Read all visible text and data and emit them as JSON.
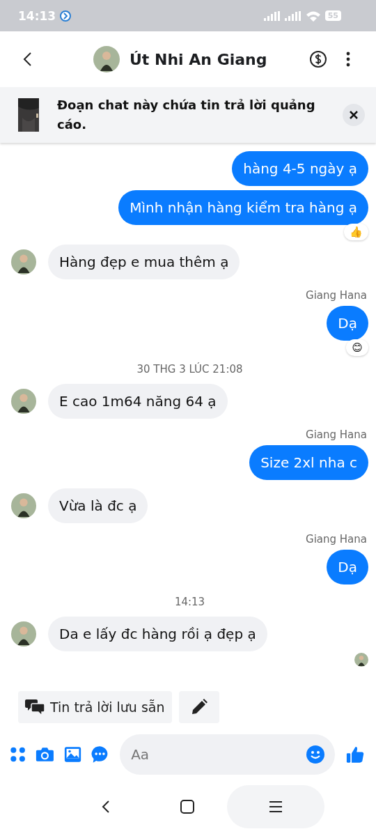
{
  "status_bar": {
    "time": "14:13",
    "battery": "55"
  },
  "header": {
    "title": "Út Nhi An Giang"
  },
  "banner": {
    "text": "Đoạn chat này chứa tin trả lời quảng cáo.",
    "kind": "picture"
  },
  "messages": [
    {
      "kind": "outgoing",
      "text": "hàng 4-5 ngày ạ"
    },
    {
      "kind": "outgoing",
      "text": "Mình nhận hàng kiểm tra hàng ạ",
      "reaction": "👍"
    },
    {
      "kind": "incoming",
      "text": "Hàng đẹp e mua thêm ạ"
    },
    {
      "kind": "sender",
      "text": "Giang Hana"
    },
    {
      "kind": "outgoing",
      "text": "Dạ",
      "reaction": "😊"
    },
    {
      "kind": "timestamp",
      "text": "30 THG 3 LÚC 21:08"
    },
    {
      "kind": "incoming",
      "text": "E cao 1m64 năng 64 ạ"
    },
    {
      "kind": "sender",
      "text": "Giang Hana"
    },
    {
      "kind": "outgoing",
      "text": "Size 2xl nha c"
    },
    {
      "kind": "incoming",
      "text": "Vừa là đc ạ"
    },
    {
      "kind": "sender",
      "text": "Giang Hana"
    },
    {
      "kind": "outgoing",
      "text": "Dạ"
    },
    {
      "kind": "timestamp",
      "text": "14:13"
    },
    {
      "kind": "incoming",
      "text": "Da e lấy đc hàng rồi ạ đẹp ạ"
    },
    {
      "kind": "seen"
    }
  ],
  "quick_replies": {
    "label": "Tin trả lời lưu sẵn"
  },
  "composer": {
    "placeholder": "Aa"
  }
}
